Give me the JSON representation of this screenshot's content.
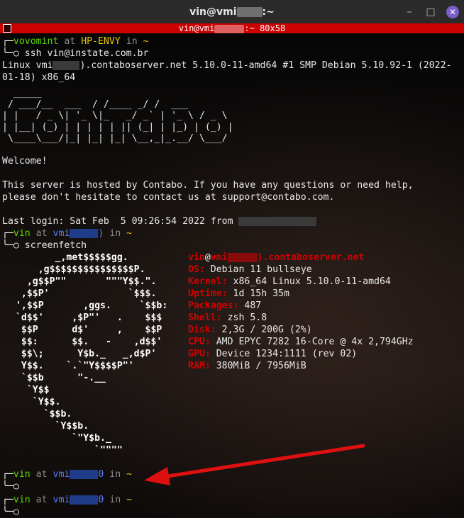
{
  "window": {
    "title_prefix": "vin@vmi",
    "title_suffix": ":~",
    "minimize_glyph": "–",
    "maximize_glyph": "□",
    "close_glyph": "✕"
  },
  "tab": {
    "title_prefix": "vin@vmi",
    "title_suffix": ":~ 80x58"
  },
  "local_prompt": {
    "user": "vovomint",
    "at": "at",
    "host": "HP-ENVY",
    "in": "in",
    "dir": "~",
    "command": "ssh vin@instate.com.br"
  },
  "motd": {
    "linux_line1_prefix": "Linux vmi",
    "linux_line1_suffix": ").contaboserver.net 5.10.0-11-amd64 #1 SMP Debian 5.10.92-1 (2022-",
    "linux_line2": "01-18) x86_64",
    "banner": [
      "  _____",
      " / ___/__  ___  / /____ _/ /  ___",
      "| |   / _ \\| '_ \\|_   _/ _` | '_ \\ / _ \\",
      "| |__| (_) | | | | | || (_| | |_) | (_) |",
      " \\____\\___/|_| |_| |_| \\__,_|_.__/ \\___/"
    ],
    "welcome": "Welcome!",
    "hosted1": "This server is hosted by Contabo. If you have any questions or need help,",
    "hosted2": "please don't hesitate to contact us at support@contabo.com.",
    "last_login": "Last login: Sat Feb  5 09:26:54 2022 from"
  },
  "remote_prompt": {
    "user": "vin",
    "at": "at",
    "host_prefix": "vmi",
    "host_suffix1": ")",
    "host_suffix2": "0",
    "in": "in",
    "dir": "~",
    "command": "screenfetch"
  },
  "screenfetch": {
    "logo": [
      "        _,met$$$$$gg.",
      "     ,g$$$$$$$$$$$$$$$P.",
      "   ,g$$P\"\"       \"\"\"Y$$.\".",
      "  ,$$P'              `$$$.",
      " ',$$P       ,ggs.     `$$b:",
      " `d$$'     ,$P\"'   .    $$$",
      "  $$P      d$'     ,    $$P",
      "  $$:      $$.   -    ,d$$'",
      "  $$\\;      Y$b._   _,d$P'",
      "  Y$$.    `.`\"Y$$$$P\"'",
      "  `$$b      \"-.__",
      "   `Y$$",
      "    `Y$$.",
      "      `$$b.",
      "        `Y$$b.",
      "           `\"Y$b._",
      "               `\"\"\"\""
    ],
    "header_user": "vin",
    "header_at": "@",
    "header_prefix": "vmi",
    "header_suffix": ").contaboserver.net",
    "info": [
      {
        "key": "OS:",
        "value": "Debian 11 bullseye"
      },
      {
        "key": "Kernel:",
        "value": "x86_64 Linux 5.10.0-11-amd64"
      },
      {
        "key": "Uptime:",
        "value": "1d 15h 35m"
      },
      {
        "key": "Packages:",
        "value": "487"
      },
      {
        "key": "Shell:",
        "value": "zsh 5.8"
      },
      {
        "key": "Disk:",
        "value": "2,3G / 200G (2%)"
      },
      {
        "key": "CPU:",
        "value": "AMD EPYC 7282 16-Core @ 4x 2,794GHz"
      },
      {
        "key": "GPU:",
        "value": "Device 1234:1111 (rev 02)"
      },
      {
        "key": "RAM:",
        "value": "380MiB / 7956MiB"
      }
    ]
  },
  "colors": {
    "titlebar": "#2b2b2b",
    "tabbar": "#cc0000",
    "prompt_user": "#5fd700",
    "prompt_host": "#5c7cff",
    "screenfetch_red": "#d40000",
    "arrow": "#e01010"
  }
}
